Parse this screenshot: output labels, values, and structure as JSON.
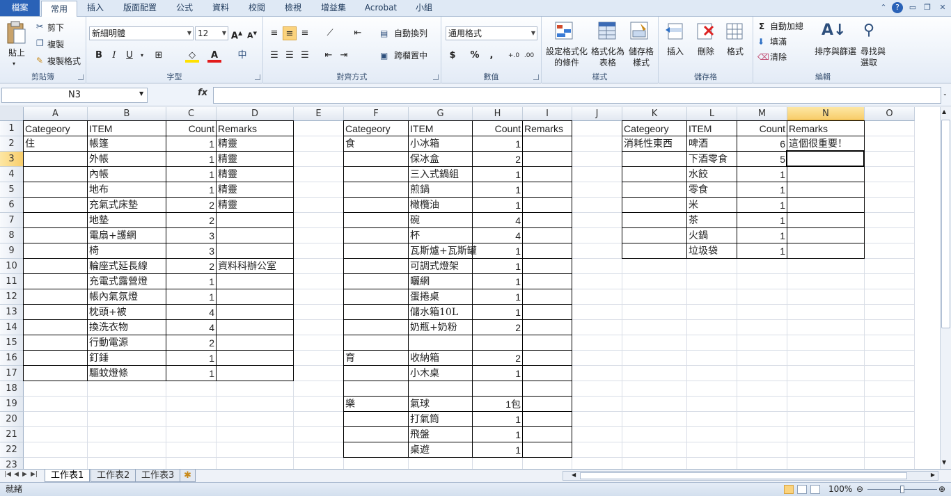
{
  "tabs": [
    "檔案",
    "常用",
    "插入",
    "版面配置",
    "公式",
    "資料",
    "校閱",
    "檢視",
    "增益集",
    "Acrobat",
    "小組"
  ],
  "ribbon": {
    "clipboard": {
      "paste": "貼上",
      "cut": "剪下",
      "copy": "複製",
      "format_painter": "複製格式",
      "label": "剪貼簿"
    },
    "font": {
      "name": "新細明體",
      "size": "12",
      "bold": "B",
      "italic": "I",
      "underline": "U",
      "label": "字型"
    },
    "alignment": {
      "wrap": "自動換列",
      "merge": "跨欄置中",
      "label": "對齊方式"
    },
    "number": {
      "format": "通用格式",
      "currency": "$",
      "percent": "%",
      "comma": ",",
      "label": "數值"
    },
    "styles": {
      "cond": "設定格式化的條件",
      "table": "格式化為表格",
      "cell": "儲存格樣式",
      "label": "樣式"
    },
    "cells": {
      "insert": "插入",
      "delete": "刪除",
      "format": "格式",
      "label": "儲存格"
    },
    "editing": {
      "autosum": "自動加總",
      "fill": "填滿",
      "clear": "清除",
      "sort": "排序與篩選",
      "find": "尋找與選取",
      "label": "編輯"
    }
  },
  "namebox": "N3",
  "fx": "fx",
  "columns": [
    "A",
    "B",
    "C",
    "D",
    "E",
    "F",
    "G",
    "H",
    "I",
    "J",
    "K",
    "L",
    "M",
    "N",
    "O"
  ],
  "rows": [
    "1",
    "2",
    "3",
    "4",
    "5",
    "6",
    "7",
    "8",
    "9",
    "10",
    "11",
    "12",
    "13",
    "14",
    "15",
    "16",
    "17",
    "18",
    "19",
    "20",
    "21",
    "22",
    "23"
  ],
  "sheet1": {
    "header": [
      "Categeory",
      "ITEM",
      "Count",
      "Remarks"
    ],
    "rows": [
      [
        "住",
        "帳篷",
        "1",
        "精靈"
      ],
      [
        "",
        "外帳",
        "1",
        "精靈"
      ],
      [
        "",
        "內帳",
        "1",
        "精靈"
      ],
      [
        "",
        "地布",
        "1",
        "精靈"
      ],
      [
        "",
        "充氣式床墊",
        "2",
        "精靈"
      ],
      [
        "",
        "地墊",
        "2",
        ""
      ],
      [
        "",
        "電扇+護網",
        "3",
        ""
      ],
      [
        "",
        "椅",
        "3",
        ""
      ],
      [
        "",
        "輪座式延長線",
        "2",
        "資料科辦公室"
      ],
      [
        "",
        "充電式露營燈",
        "1",
        ""
      ],
      [
        "",
        "帳內氣氛燈",
        "1",
        ""
      ],
      [
        "",
        "枕頭+被",
        "4",
        ""
      ],
      [
        "",
        "換洗衣物",
        "4",
        ""
      ],
      [
        "",
        "行動電源",
        "2",
        ""
      ],
      [
        "",
        "釘錘",
        "1",
        ""
      ],
      [
        "",
        "驅蚊燈條",
        "1",
        ""
      ]
    ]
  },
  "sheet2": {
    "header": [
      "Categeory",
      "ITEM",
      "Count",
      "Remarks"
    ],
    "rows": [
      [
        "食",
        "小冰箱",
        "1",
        ""
      ],
      [
        "",
        "保冰盒",
        "2",
        ""
      ],
      [
        "",
        "三入式鍋組",
        "1",
        ""
      ],
      [
        "",
        "煎鍋",
        "1",
        ""
      ],
      [
        "",
        "橄欖油",
        "1",
        ""
      ],
      [
        "",
        "碗",
        "4",
        ""
      ],
      [
        "",
        "杯",
        "4",
        ""
      ],
      [
        "",
        "瓦斯爐+瓦斯罐",
        "1",
        ""
      ],
      [
        "",
        "可調式燈架",
        "1",
        ""
      ],
      [
        "",
        "曬網",
        "1",
        ""
      ],
      [
        "",
        "蛋捲桌",
        "1",
        ""
      ],
      [
        "",
        "儲水箱10L",
        "1",
        ""
      ],
      [
        "",
        "奶瓶+奶粉",
        "2",
        ""
      ],
      [
        "",
        "",
        "",
        ""
      ],
      [
        "育",
        "收納箱",
        "2",
        ""
      ],
      [
        "",
        "小木桌",
        "1",
        ""
      ],
      [
        "",
        "",
        "",
        ""
      ],
      [
        "樂",
        "氣球",
        "1包",
        ""
      ],
      [
        "",
        "打氣筒",
        "1",
        ""
      ],
      [
        "",
        "飛盤",
        "1",
        ""
      ],
      [
        "",
        "桌遊",
        "1",
        ""
      ]
    ]
  },
  "sheet3": {
    "header": [
      "Categeory",
      "ITEM",
      "Count",
      "Remarks"
    ],
    "rows": [
      [
        "消耗性東西",
        "啤酒",
        "6",
        "這個很重要！"
      ],
      [
        "",
        "下酒零食",
        "5",
        ""
      ],
      [
        "",
        "水餃",
        "1",
        ""
      ],
      [
        "",
        "零食",
        "1",
        ""
      ],
      [
        "",
        "米",
        "1",
        ""
      ],
      [
        "",
        "茶",
        "1",
        ""
      ],
      [
        "",
        "火鍋",
        "1",
        ""
      ],
      [
        "",
        "垃圾袋",
        "1",
        ""
      ]
    ]
  },
  "sheet_tabs": [
    "工作表1",
    "工作表2",
    "工作表3"
  ],
  "status": {
    "ready": "就緒",
    "zoom": "100%"
  }
}
